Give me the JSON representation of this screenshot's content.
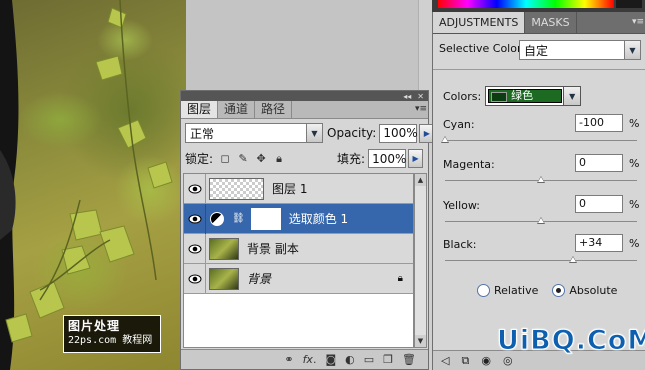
{
  "layers_panel": {
    "tabs": [
      "图层",
      "通道",
      "路径"
    ],
    "blend_mode": "正常",
    "opacity_label": "Opacity:",
    "opacity_value": "100%",
    "lock_label": "锁定:",
    "fill_label": "填充:",
    "fill_value": "100%",
    "layers": [
      {
        "name": "图层 1",
        "type": "empty-layer",
        "visible": true,
        "selected": false
      },
      {
        "name": "选取颜色 1",
        "type": "adjustment-layer",
        "visible": true,
        "selected": true
      },
      {
        "name": "背景 副本",
        "type": "photo-layer",
        "visible": true,
        "selected": false
      },
      {
        "name": "背景",
        "type": "background-layer",
        "visible": true,
        "selected": false,
        "locked": true
      }
    ]
  },
  "adjustments_panel": {
    "tabs": [
      "ADJUSTMENTS",
      "MASKS"
    ],
    "title": "Selective Color",
    "preset": "自定",
    "colors_label": "Colors:",
    "colors_value": "绿色",
    "colors_swatch": "#1d6b23",
    "sliders": [
      {
        "label": "Cyan:",
        "value": "-100",
        "unit": "%"
      },
      {
        "label": "Magenta:",
        "value": "0",
        "unit": "%"
      },
      {
        "label": "Yellow:",
        "value": "0",
        "unit": "%"
      },
      {
        "label": "Black:",
        "value": "+34",
        "unit": "%"
      }
    ],
    "method": {
      "relative": "Relative",
      "absolute": "Absolute",
      "selected": "absolute"
    }
  },
  "watermark": {
    "line1": "图片处理",
    "line2": "22ps.com",
    "line3": "教程网"
  },
  "brand": "UiBQ.CoM",
  "colors": {
    "selection": "#3667ad",
    "panel": "#d6d6d6",
    "brand": "#0d5fb0"
  }
}
